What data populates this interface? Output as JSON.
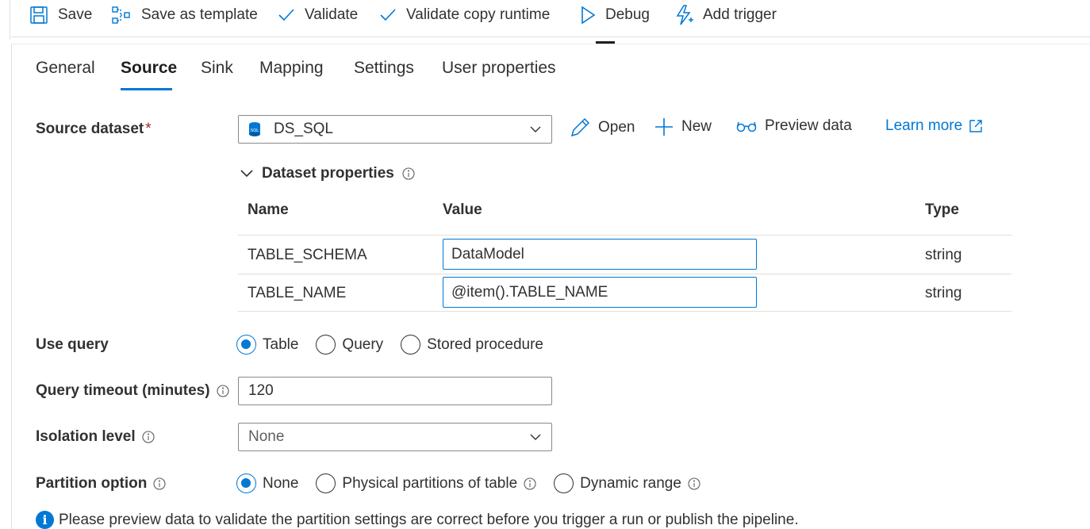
{
  "toolbar": {
    "save": "Save",
    "save_template": "Save as template",
    "validate": "Validate",
    "validate_copy": "Validate copy runtime",
    "debug": "Debug",
    "add_trigger": "Add trigger"
  },
  "tabs": [
    "General",
    "Source",
    "Sink",
    "Mapping",
    "Settings",
    "User properties"
  ],
  "active_tab": "Source",
  "source": {
    "dataset_label": "Source dataset",
    "required_mark": "*",
    "dataset_value": "DS_SQL",
    "actions": {
      "open": "Open",
      "new": "New",
      "preview": "Preview data",
      "learn_more": "Learn more"
    }
  },
  "dataset_properties": {
    "heading": "Dataset properties",
    "columns": [
      "Name",
      "Value",
      "Type"
    ],
    "rows": [
      {
        "name": "TABLE_SCHEMA",
        "value": "DataModel",
        "type": "string"
      },
      {
        "name": "TABLE_NAME",
        "value": "@item().TABLE_NAME",
        "type": "string"
      }
    ]
  },
  "use_query": {
    "label": "Use query",
    "options": [
      "Table",
      "Query",
      "Stored procedure"
    ],
    "selected": "Table"
  },
  "query_timeout": {
    "label": "Query timeout (minutes)",
    "value": "120"
  },
  "isolation_level": {
    "label": "Isolation level",
    "value": "None"
  },
  "partition_option": {
    "label": "Partition option",
    "options": [
      "None",
      "Physical partitions of table",
      "Dynamic range"
    ],
    "selected": "None"
  },
  "note": "Please preview data to validate the partition settings are correct before you trigger a run or publish the pipeline.",
  "colors": {
    "accent": "#0078d4",
    "required": "#a4262c",
    "text": "#323130",
    "border": "#8a8886"
  }
}
